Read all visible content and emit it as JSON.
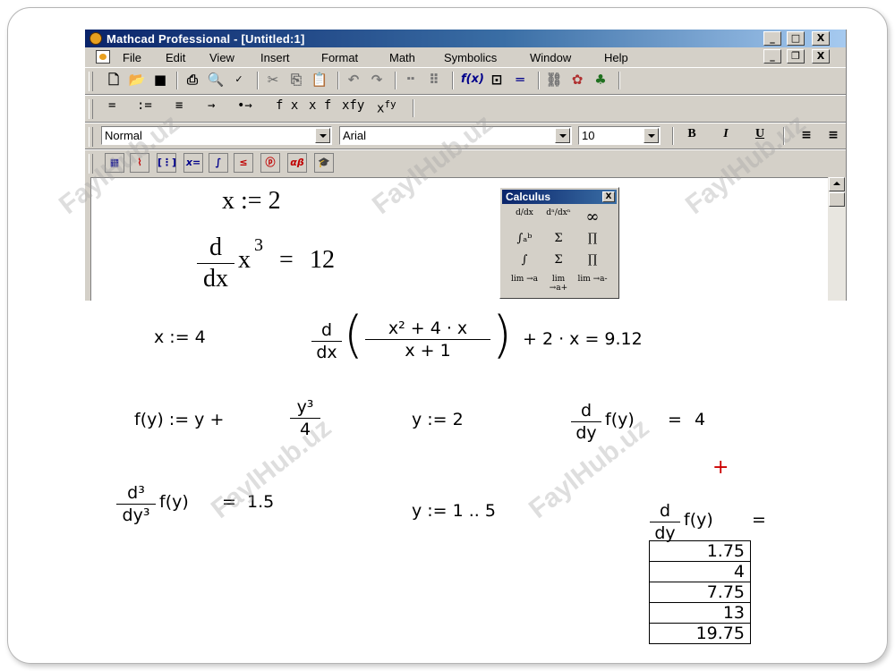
{
  "window": {
    "title": "Mathcad Professional - [Untitled:1]",
    "controls": {
      "minimize": "_",
      "maximize": "□",
      "close": "X"
    }
  },
  "menu": {
    "items": [
      "File",
      "Edit",
      "View",
      "Insert",
      "Format",
      "Math",
      "Symbolics",
      "Window",
      "Help"
    ],
    "doc_controls": {
      "minimize": "_",
      "restore": "❐",
      "close": "X"
    }
  },
  "eval_toolbar": {
    "ops": [
      "=",
      ":=",
      "≡",
      "→",
      "•→",
      "f x",
      "x f",
      "xfy",
      "x"
    ],
    "xfy_sup": "fy"
  },
  "format_toolbar": {
    "style": "Normal",
    "font": "Arial",
    "size": "10",
    "bold": "B",
    "italic": "I",
    "underline": "U"
  },
  "palette_toolbar": {
    "buttons": [
      "calculator",
      "graph",
      "matrix",
      "x=",
      "∫",
      "programming",
      "symbolic",
      "αβ",
      "symbolic-keyword"
    ]
  },
  "calculus_palette": {
    "title": "Calculus",
    "close": "X",
    "cells": [
      "d/dx",
      "dⁿ/dxⁿ",
      "∞",
      "∫ₐᵇ",
      "Σ",
      "∏",
      "∫",
      "Σ",
      "∏",
      "lim →a",
      "lim →a+",
      "lim →a-"
    ]
  },
  "worksheet": {
    "eq1": {
      "lhs": "x",
      "op": ":=",
      "rhs": "2"
    },
    "eq2": {
      "d": "d",
      "dx": "dx",
      "body": "x",
      "exp": "3",
      "eq": "=",
      "result": "12"
    }
  },
  "slide": {
    "eq3": {
      "lhs": "x",
      "op": ":=",
      "rhs": "4"
    },
    "eq4": {
      "d": "d",
      "dx": "dx",
      "num": "x² + 4 · x",
      "den": "x + 1",
      "tail": "+ 2 · x = 9.12"
    },
    "eq5": {
      "lhs": "f(y) := y +",
      "num": "y³",
      "den": "4"
    },
    "eq6": {
      "text": "y := 2"
    },
    "eq7": {
      "d": "d",
      "dy": "dy",
      "body": "f(y)",
      "eq": "=",
      "result": "4"
    },
    "eq8": {
      "d": "d³",
      "dy": "dy³",
      "body": "f(y)",
      "eq": "=",
      "result": "1.5"
    },
    "eq9": {
      "text": "y := 1 .. 5"
    },
    "eq10": {
      "d": "d",
      "dy": "dy",
      "body": "f(y)",
      "eq": "="
    },
    "results": [
      "1.75",
      "4",
      "7.75",
      "13",
      "19.75"
    ],
    "cursor": "+"
  },
  "watermark": "FaylHub.uz"
}
